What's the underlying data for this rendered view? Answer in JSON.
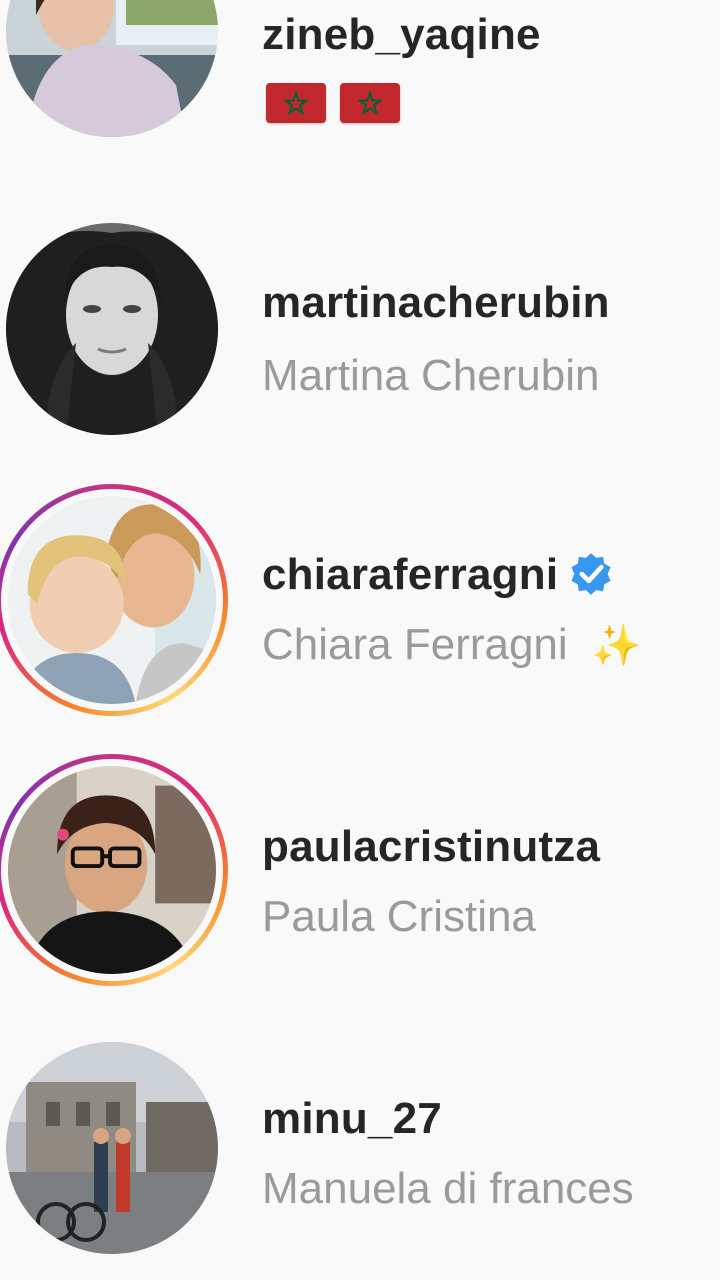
{
  "accounts": [
    {
      "username": "zineb_yaqine",
      "fullname": "",
      "flags": [
        "morocco-flag",
        "morocco-flag"
      ],
      "has_story": false,
      "verified": false
    },
    {
      "username": "martinacherubin",
      "fullname": "Martina Cherubin",
      "has_story": false,
      "verified": false
    },
    {
      "username": "chiaraferragni",
      "fullname": "Chiara Ferragni",
      "has_story": true,
      "verified": true,
      "suffix_icon": "sparkles-icon"
    },
    {
      "username": "paulacristinutza",
      "fullname": "Paula Cristina",
      "has_story": true,
      "verified": false
    },
    {
      "username": "minu_27",
      "fullname": "Manuela di frances",
      "has_story": false,
      "verified": false
    }
  ],
  "colors": {
    "username": "#262626",
    "fullname": "#9a9a9a",
    "verified": "#3897f0",
    "flag_red": "#c1272d",
    "flag_star": "#006233"
  }
}
